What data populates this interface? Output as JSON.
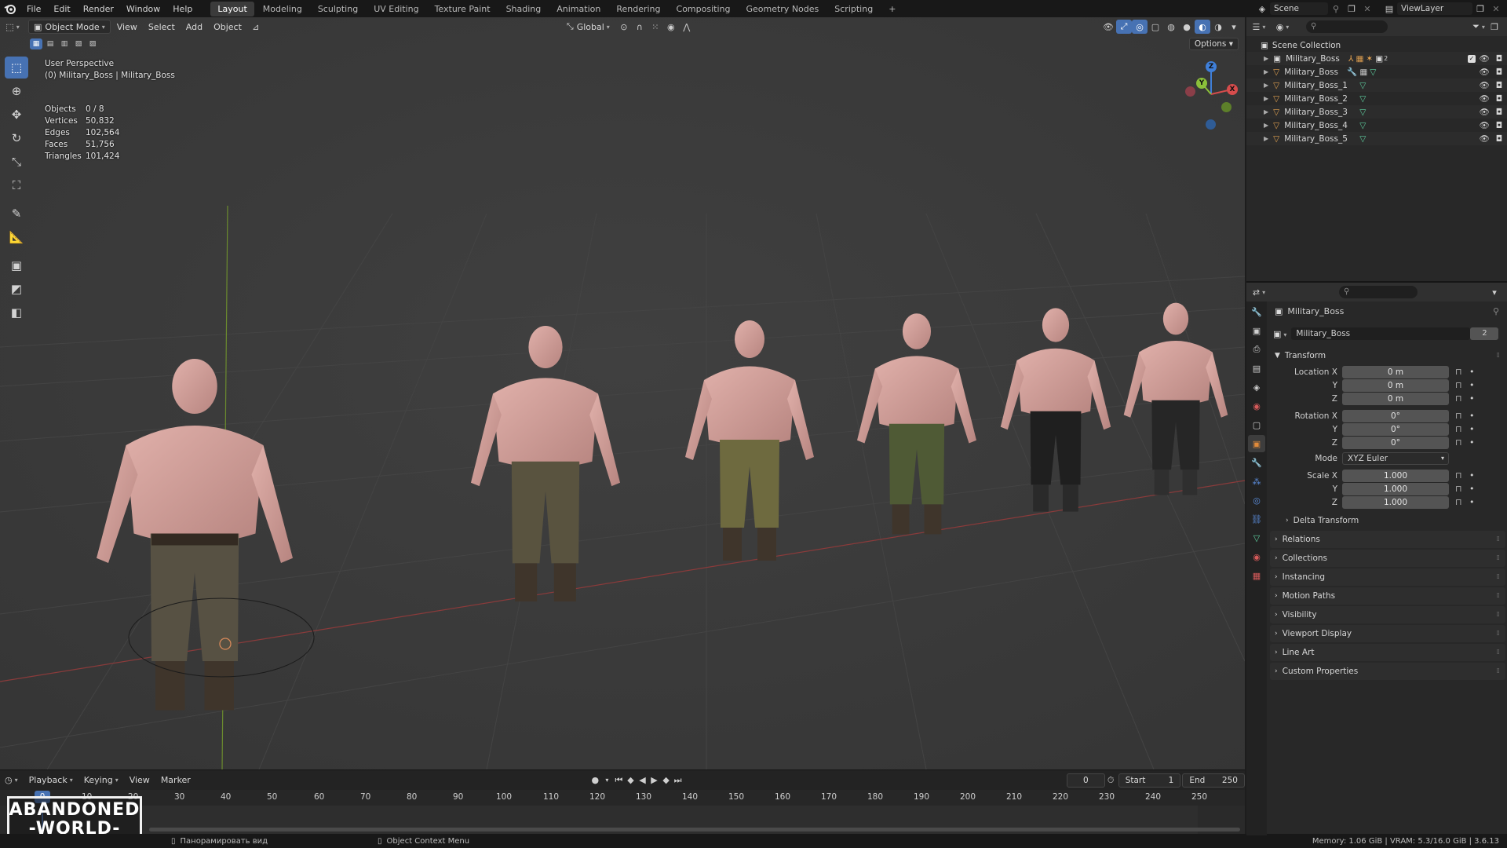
{
  "topbar": {
    "menus": [
      "File",
      "Edit",
      "Render",
      "Window",
      "Help"
    ],
    "workspaces": [
      "Layout",
      "Modeling",
      "Sculpting",
      "UV Editing",
      "Texture Paint",
      "Shading",
      "Animation",
      "Rendering",
      "Compositing",
      "Geometry Nodes",
      "Scripting"
    ],
    "active_workspace": "Layout",
    "add_tab": "+",
    "scene_label": "Scene",
    "viewlayer_label": "ViewLayer"
  },
  "viewport_header": {
    "mode": "Object Mode",
    "menus": [
      "View",
      "Select",
      "Add",
      "Object"
    ],
    "transform_orientation": "Global",
    "options_label": "Options"
  },
  "overlay": {
    "perspective": "User Perspective",
    "collection_info": "(0) Military_Boss | Military_Boss"
  },
  "stats": [
    {
      "label": "Objects",
      "value": "0 / 8"
    },
    {
      "label": "Vertices",
      "value": "50,832"
    },
    {
      "label": "Edges",
      "value": "102,564"
    },
    {
      "label": "Faces",
      "value": "51,756"
    },
    {
      "label": "Triangles",
      "value": "101,424"
    }
  ],
  "gizmo": {
    "x": "X",
    "y": "Y",
    "z": "Z"
  },
  "timeline": {
    "menus": [
      "Playback",
      "Keying",
      "View",
      "Marker"
    ],
    "current_frame": "0",
    "start_label": "Start",
    "start_value": "1",
    "end_label": "End",
    "end_value": "250",
    "ticks": [
      "0",
      "10",
      "20",
      "30",
      "40",
      "50",
      "60",
      "70",
      "80",
      "90",
      "100",
      "110",
      "120",
      "130",
      "140",
      "150",
      "160",
      "170",
      "180",
      "190",
      "200",
      "210",
      "220",
      "230",
      "240",
      "250"
    ]
  },
  "statusbar": {
    "hint_left": "Панорамировать вид",
    "hint_mid": "Object Context Menu",
    "memory": "Memory: 1.06 GiB | VRAM: 5.3/16.0 GiB | 3.6.13"
  },
  "outliner": {
    "root": "Scene Collection",
    "items": [
      {
        "name": "Military_Boss",
        "type": "armature",
        "badge": "2"
      },
      {
        "name": "Military_Boss",
        "type": "mesh",
        "badge": ""
      },
      {
        "name": "Military_Boss_1",
        "type": "mesh",
        "badge": ""
      },
      {
        "name": "Military_Boss_2",
        "type": "mesh",
        "badge": ""
      },
      {
        "name": "Military_Boss_3",
        "type": "mesh",
        "badge": ""
      },
      {
        "name": "Military_Boss_4",
        "type": "mesh",
        "badge": ""
      },
      {
        "name": "Military_Boss_5",
        "type": "mesh",
        "badge": ""
      }
    ]
  },
  "properties": {
    "object_name": "Military_Boss",
    "data_name": "Military_Boss",
    "data_users": "2",
    "transform_title": "Transform",
    "location": {
      "label": "Location X",
      "x": "0 m",
      "y": "0 m",
      "z": "0 m"
    },
    "rotation": {
      "label": "Rotation X",
      "x": "0°",
      "y": "0°",
      "z": "0°"
    },
    "mode_label": "Mode",
    "mode_value": "XYZ Euler",
    "scale": {
      "label": "Scale X",
      "x": "1.000",
      "y": "1.000",
      "z": "1.000"
    },
    "axis_y": "Y",
    "axis_z": "Z",
    "delta_transform": "Delta Transform",
    "panels": [
      "Relations",
      "Collections",
      "Instancing",
      "Motion Paths",
      "Visibility",
      "Viewport Display",
      "Line Art",
      "Custom Properties"
    ]
  },
  "watermark": {
    "line1": "ABANDONED",
    "line2": "-WORLD-"
  },
  "colors": {
    "accent": "#4772b3",
    "viewport_bg": "#3a3a3a",
    "panel_bg": "#282828",
    "x_axis": "#d64c4c",
    "y_axis": "#8bbf3a",
    "z_axis": "#3f7fd9"
  }
}
